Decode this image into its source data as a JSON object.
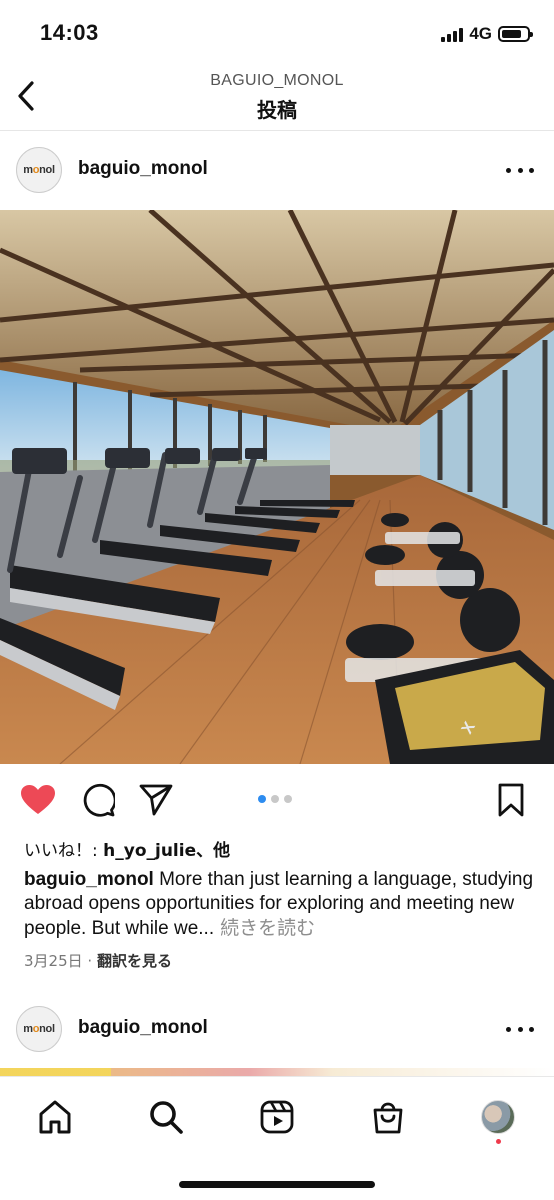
{
  "status": {
    "time": "14:03",
    "network": "4G"
  },
  "header": {
    "subtitle": "BAGUIO_MONOL",
    "title": "投稿"
  },
  "post": {
    "avatar_text_pre": "m",
    "avatar_text_o": "o",
    "avatar_text_post": "nol",
    "username": "baguio_monol",
    "likes_prefix": "いいね！: ",
    "likes_user": "h_yo_julie",
    "likes_suffix": "、他",
    "caption_user": "baguio_monol",
    "caption_text": " More than just learning a language, studying abroad opens opportunities for exploring and meeting new people. But while we...",
    "caption_more": " 続きを読む",
    "date": "3月25日",
    "separator": " · ",
    "translate": "翻訳を見る",
    "carousel": {
      "count": 3,
      "active": 0
    }
  },
  "next_post": {
    "avatar_text_pre": "m",
    "avatar_text_o": "o",
    "avatar_text_post": "nol",
    "username": "baguio_monol"
  },
  "colors": {
    "like": "#ed4956",
    "accent": "#2d8cf0",
    "notification": "#ef3a4b"
  },
  "icons": {
    "back": "chevron-left-icon",
    "like": "heart-icon",
    "comment": "comment-icon",
    "share": "paper-plane-icon",
    "save": "bookmark-icon",
    "more": "more-horizontal-icon",
    "nav_home": "home-icon",
    "nav_search": "search-icon",
    "nav_reels": "reels-icon",
    "nav_shop": "shopping-bag-icon",
    "nav_profile": "profile-avatar"
  }
}
